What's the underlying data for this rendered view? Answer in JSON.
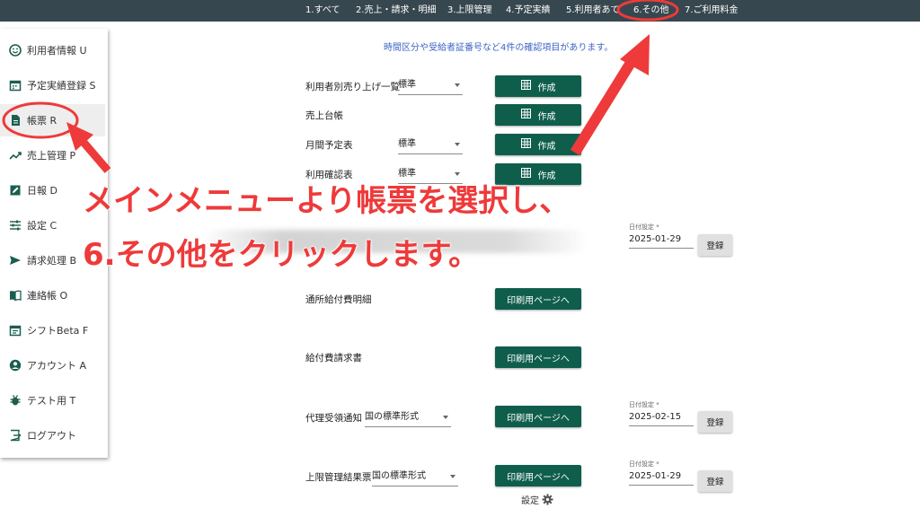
{
  "topnav": {
    "tabs": [
      {
        "label": "1.すべて"
      },
      {
        "label": "2.売上・請求・明細"
      },
      {
        "label": "3.上限管理"
      },
      {
        "label": "4.予定実績"
      },
      {
        "label": "5.利用者あて"
      },
      {
        "label": "6.その他"
      },
      {
        "label": "7.ご利用料金"
      }
    ]
  },
  "sidebar": {
    "items": [
      {
        "label": "利用者情報 U",
        "icon": "smiley-icon"
      },
      {
        "label": "予定実績登録 S",
        "icon": "calendar-icon"
      },
      {
        "label": "帳票 R",
        "icon": "document-icon"
      },
      {
        "label": "売上管理 P",
        "icon": "trending-up-icon"
      },
      {
        "label": "日報 D",
        "icon": "edit-note-icon"
      },
      {
        "label": "設定 C",
        "icon": "sliders-icon"
      },
      {
        "label": "請求処理 B",
        "icon": "send-icon"
      },
      {
        "label": "連絡帳 O",
        "icon": "book-icon"
      },
      {
        "label": "シフトBeta F",
        "icon": "event-note-icon"
      },
      {
        "label": "アカウント A",
        "icon": "account-icon"
      },
      {
        "label": "テスト用 T",
        "icon": "bug-icon"
      },
      {
        "label": "ログアウト",
        "icon": "logout-icon"
      }
    ]
  },
  "main": {
    "info": "時間区分や受給者証番号など4件の確認項目があります。",
    "rows": [
      {
        "label": "利用者別売り上げ一覧",
        "select": "標準",
        "button": "作成"
      },
      {
        "label": "売上台帳",
        "button": "作成"
      },
      {
        "label": "月間予定表",
        "select": "標準",
        "button": "作成"
      },
      {
        "label": "利用確認表",
        "select": "標準",
        "button": "作成"
      },
      {
        "label": "通所給付費明細",
        "button": "印刷用ページへ"
      },
      {
        "label": "給付費請求書",
        "button": "印刷用ページへ"
      },
      {
        "label": "代理受領通知",
        "select": "国の標準形式",
        "button": "印刷用ページへ"
      },
      {
        "label": "上限管理結果票",
        "select": "国の標準形式",
        "button": "印刷用ページへ"
      }
    ],
    "date_fields": [
      {
        "label": "日付設定 *",
        "value": "2025-01-29",
        "button": "登録"
      },
      {
        "label": "日付設定 *",
        "value": "2025-02-15",
        "button": "登録"
      },
      {
        "label": "日付設定 *",
        "value": "2025-01-29",
        "button": "登録"
      }
    ],
    "settings_label": "設定"
  },
  "annotation": {
    "line1": "メインメニューより帳票を選択し、",
    "line2": "6.その他をクリックします。",
    "color": "#ee3a3a"
  },
  "colors": {
    "topbar": "#37474f",
    "primary_button": "#0f5e4c",
    "info_text": "#3b66c4"
  }
}
